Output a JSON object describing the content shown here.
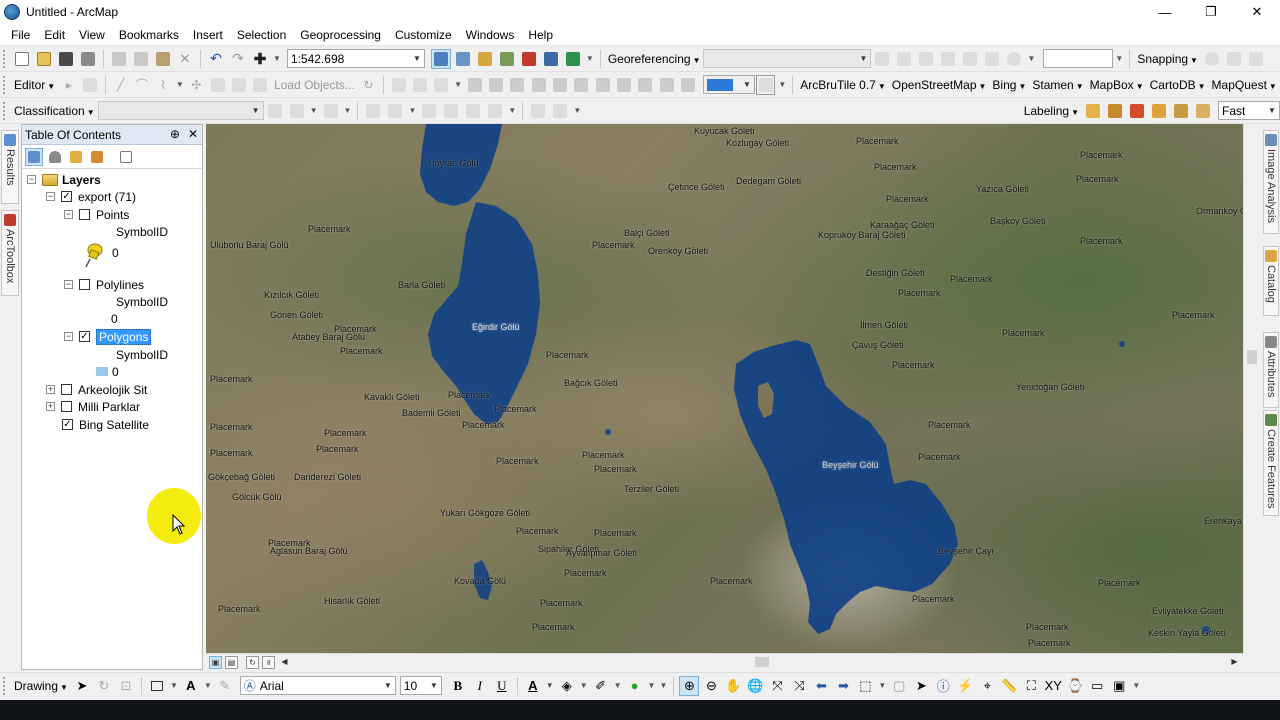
{
  "window": {
    "title": "Untitled - ArcMap",
    "minimize": "—",
    "maximize": "❐",
    "close": "✕"
  },
  "menu": [
    "File",
    "Edit",
    "View",
    "Bookmarks",
    "Insert",
    "Selection",
    "Geoprocessing",
    "Customize",
    "Windows",
    "Help"
  ],
  "toolbar1": {
    "scale": "1:542.698",
    "georeferencing": "Georeferencing",
    "snapping": "Snapping"
  },
  "toolbar2": {
    "editor": "Editor",
    "load_objects": "Load Objects...",
    "basemaps": [
      "ArcBruTile 0.7",
      "OpenStreetMap",
      "Bing",
      "Stamen",
      "MapBox",
      "CartoDB",
      "MapQuest"
    ]
  },
  "toolbar3": {
    "classification": "Classification",
    "labeling": "Labeling",
    "quality": "Fast"
  },
  "left_tabs": [
    "Results",
    "ArcToolbox"
  ],
  "right_tabs": [
    "Image Analysis",
    "Catalog",
    "Attributes",
    "Create Features"
  ],
  "toc": {
    "title": "Table Of Contents",
    "pin": "⊕",
    "close": "✕",
    "root": "Layers",
    "group": "export (71)",
    "points": {
      "name": "Points",
      "field": "SymbolID",
      "value": "0"
    },
    "polylines": {
      "name": "Polylines",
      "field": "SymbolID",
      "value": "0"
    },
    "polygons": {
      "name": "Polygons",
      "field": "SymbolID",
      "value": "0"
    },
    "other_layers": [
      "Arkeolojik Sit",
      "Milli Parklar",
      "Bing Satellite"
    ]
  },
  "map_labels": [
    "Kuyucak Göleti",
    "Kozlugay Göleti",
    "Dedegam Göleti",
    "Çetince Göleti",
    "Hoyran Gölü",
    "Balçi Göleti",
    "Orenköy Göleti",
    "Kopruköy Baraj Göleti",
    "Karaağaç Göleti",
    "Destiğin Göleti",
    "Yazıca Göleti",
    "Başkoy Göleti",
    "Ormankoy Göleti",
    "Uluborlu Baraj Gölü",
    "Kızılcık Göleti",
    "Gönen Göleti",
    "Barla Göleti",
    "Eğirdir Gölü",
    "Atabey Baraj Gölü",
    "İlmen Göleti",
    "Çavuş Göleti",
    "Yenidoğan Göleti",
    "Bağcık Göleti",
    "Kavaklı Göleti",
    "Bademli Göleti",
    "Beyşehir Gölü",
    "Gökçebağ Göleti",
    "Dariderezi Göleti",
    "Gölcük Gölü",
    "Terziler Göleti",
    "Yukarı Gökgöze Göleti",
    "Sipahiler Göleti",
    "Ayvalıpınar Göleti",
    "Kovada Gölü",
    "Aglasun Baraj Gölü",
    "Hisarlık Göleti",
    "Beyşehir Çayı",
    "Erenkaya Göleti",
    "Evliyatekke Göleti",
    "Keskin Yayla Göleti"
  ],
  "placemark": "Placemark",
  "drawing": {
    "label": "Drawing",
    "font": "Arial",
    "size": "10",
    "bold": "B",
    "italic": "I",
    "underline": "U",
    "text_a": "A"
  },
  "colors": {
    "water": "#0d3f86",
    "toc_header": "#dfe9f5",
    "selection": "#3399ff",
    "cursor_halo": "#f5ec0f"
  }
}
